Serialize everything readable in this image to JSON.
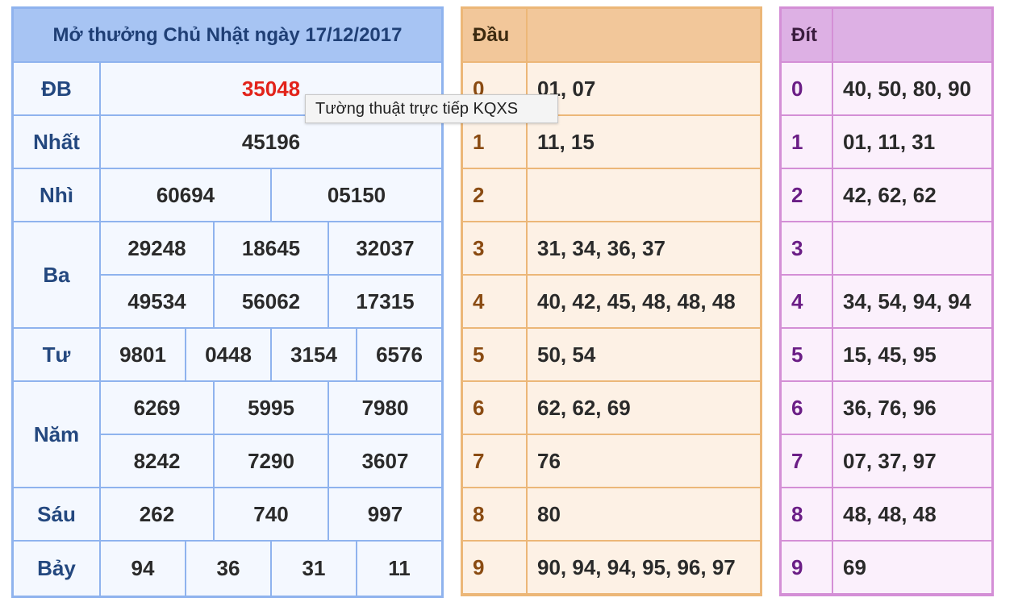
{
  "results": {
    "title": "Mở thưởng Chủ Nhật ngày 17/12/2017",
    "rows": [
      {
        "label": "ĐB",
        "values": [
          "35048"
        ]
      },
      {
        "label": "Nhất",
        "values": [
          "45196"
        ]
      },
      {
        "label": "Nhì",
        "values": [
          "60694",
          "05150"
        ]
      },
      {
        "label": "Ba",
        "values": [
          "29248",
          "18645",
          "32037",
          "49534",
          "56062",
          "17315"
        ]
      },
      {
        "label": "Tư",
        "values": [
          "9801",
          "0448",
          "3154",
          "6576"
        ]
      },
      {
        "label": "Năm",
        "values": [
          "6269",
          "5995",
          "7980",
          "8242",
          "7290",
          "3607"
        ]
      },
      {
        "label": "Sáu",
        "values": [
          "262",
          "740",
          "997"
        ]
      },
      {
        "label": "Bảy",
        "values": [
          "94",
          "36",
          "31",
          "11"
        ]
      }
    ],
    "special_color": "#e2231a"
  },
  "tooltip": "Tường thuật trực tiếp KQXS",
  "dau": {
    "header": "Đầu",
    "header_value": "",
    "rows": [
      {
        "digit": "0",
        "values": "01, 07"
      },
      {
        "digit": "1",
        "values": "11, 15"
      },
      {
        "digit": "2",
        "values": ""
      },
      {
        "digit": "3",
        "values": "31, 34, 36, 37"
      },
      {
        "digit": "4",
        "values": "40, 42, 45, 48, 48, 48"
      },
      {
        "digit": "5",
        "values": "50, 54"
      },
      {
        "digit": "6",
        "values": "62, 62, 69"
      },
      {
        "digit": "7",
        "values": "76"
      },
      {
        "digit": "8",
        "values": "80"
      },
      {
        "digit": "9",
        "values": "90, 94, 94, 95, 96, 97"
      }
    ]
  },
  "dit": {
    "header": "Đít",
    "header_value": "",
    "rows": [
      {
        "digit": "0",
        "values": "40, 50, 80, 90"
      },
      {
        "digit": "1",
        "values": "01, 11, 31"
      },
      {
        "digit": "2",
        "values": "42, 62, 62"
      },
      {
        "digit": "3",
        "values": ""
      },
      {
        "digit": "4",
        "values": "34, 54, 94, 94"
      },
      {
        "digit": "5",
        "values": "15, 45, 95"
      },
      {
        "digit": "6",
        "values": "36, 76, 96"
      },
      {
        "digit": "7",
        "values": "07, 37, 97"
      },
      {
        "digit": "8",
        "values": "48, 48, 48"
      },
      {
        "digit": "9",
        "values": "69"
      }
    ]
  }
}
